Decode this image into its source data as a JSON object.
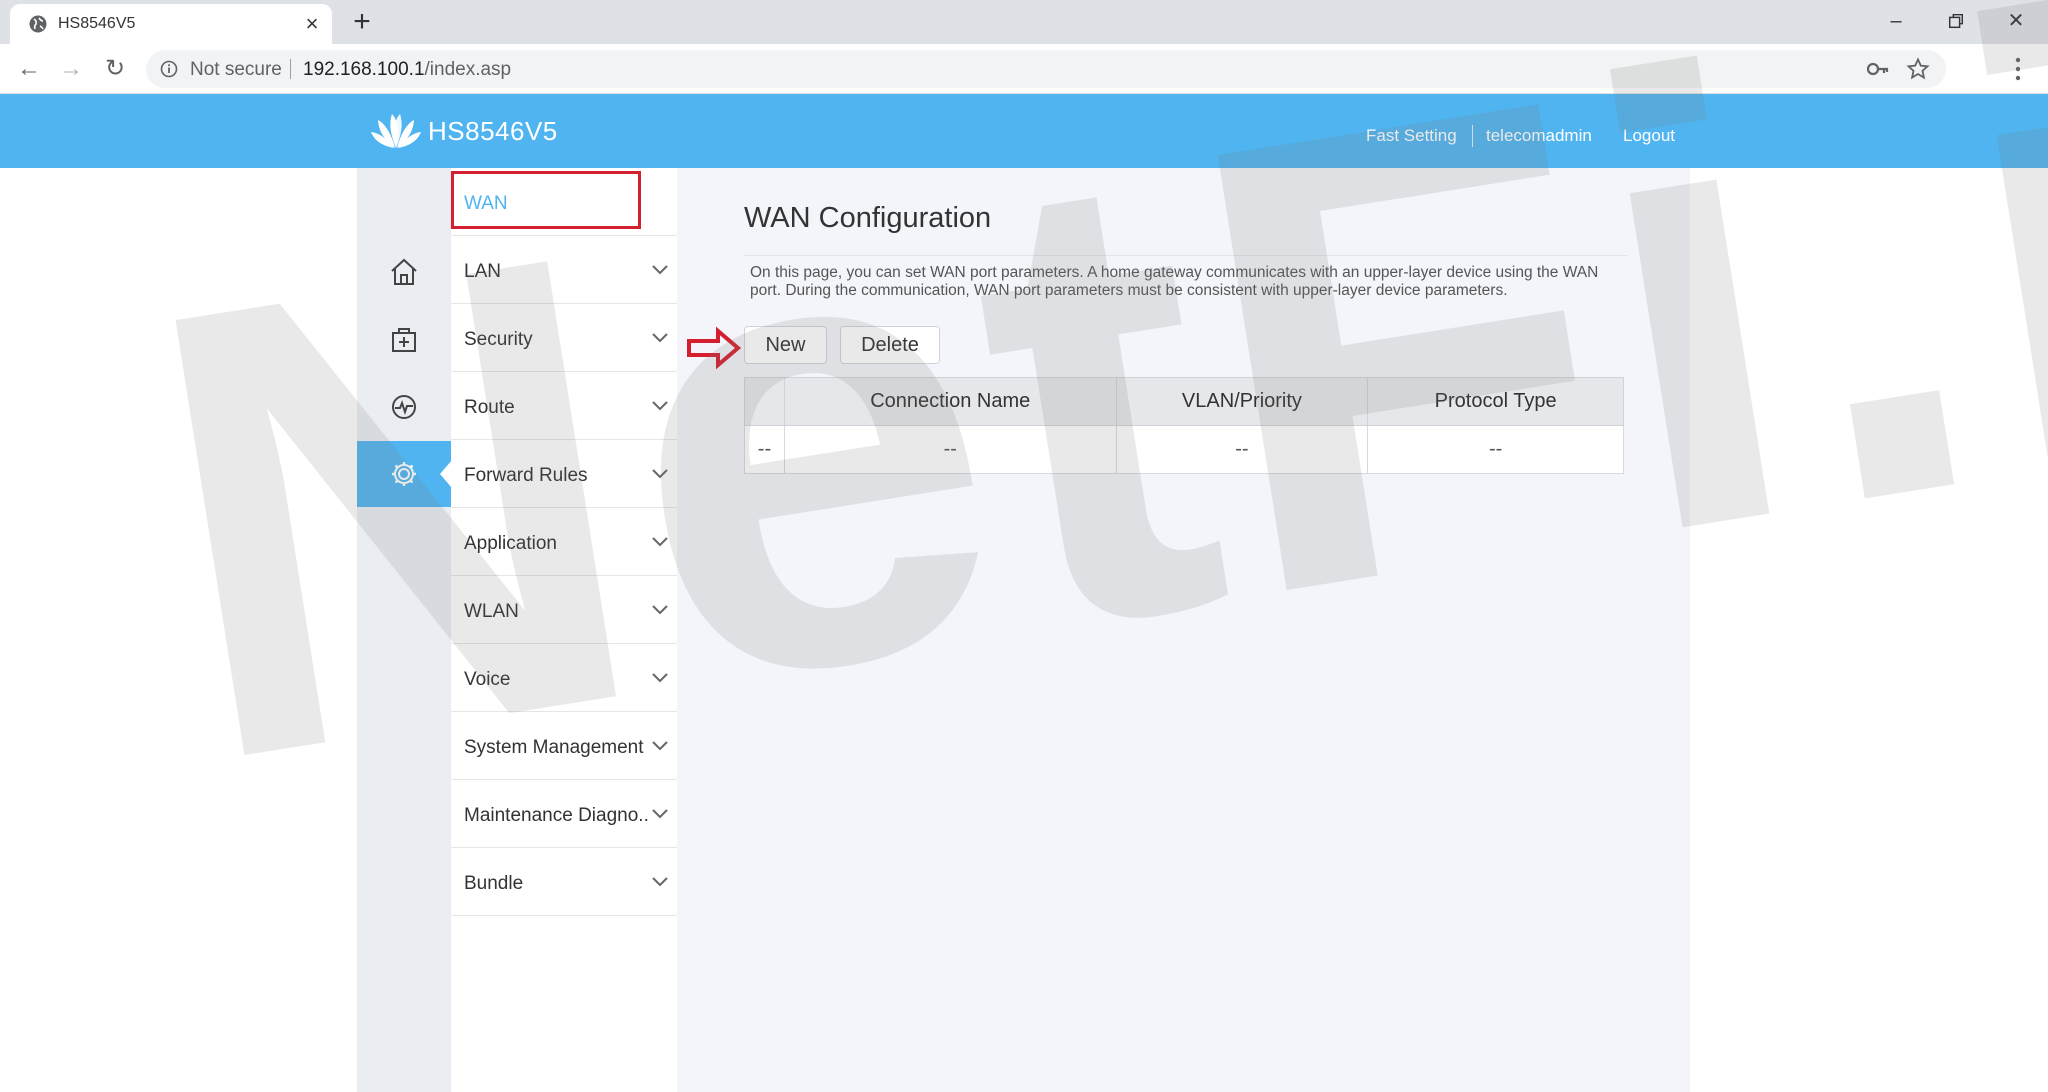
{
  "browser": {
    "tab_title": "HS8546V5",
    "security_label": "Not secure",
    "url_host": "192.168.100.1",
    "url_path": "/index.asp"
  },
  "header": {
    "brand": "HS8546V5",
    "links": [
      "Fast Setting",
      "telecomadmin",
      "Logout"
    ]
  },
  "menu": {
    "items": [
      {
        "label": "WAN",
        "selected": true
      },
      {
        "label": "LAN"
      },
      {
        "label": "Security"
      },
      {
        "label": "Route"
      },
      {
        "label": "Forward Rules"
      },
      {
        "label": "Application"
      },
      {
        "label": "WLAN"
      },
      {
        "label": "Voice"
      },
      {
        "label": "System Management"
      },
      {
        "label": "Maintenance Diagno.."
      },
      {
        "label": "Bundle"
      }
    ]
  },
  "main": {
    "title": "WAN Configuration",
    "description": "On this page, you can set WAN port parameters. A home gateway communicates with an upper-layer device using the WAN port. During the communication, WAN port parameters must be consistent with upper-layer device parameters.",
    "new_label": "New",
    "delete_label": "Delete",
    "table": {
      "headers": [
        "",
        "Connection Name",
        "VLAN/Priority",
        "Protocol Type"
      ],
      "rows": [
        [
          "--",
          "--",
          "--",
          "--"
        ]
      ]
    }
  },
  "watermark": "NetFi.ir",
  "colors": {
    "header_blue": "#50b4f0",
    "highlight_red": "#d31f2e",
    "content_bg": "#f3f5fa"
  }
}
